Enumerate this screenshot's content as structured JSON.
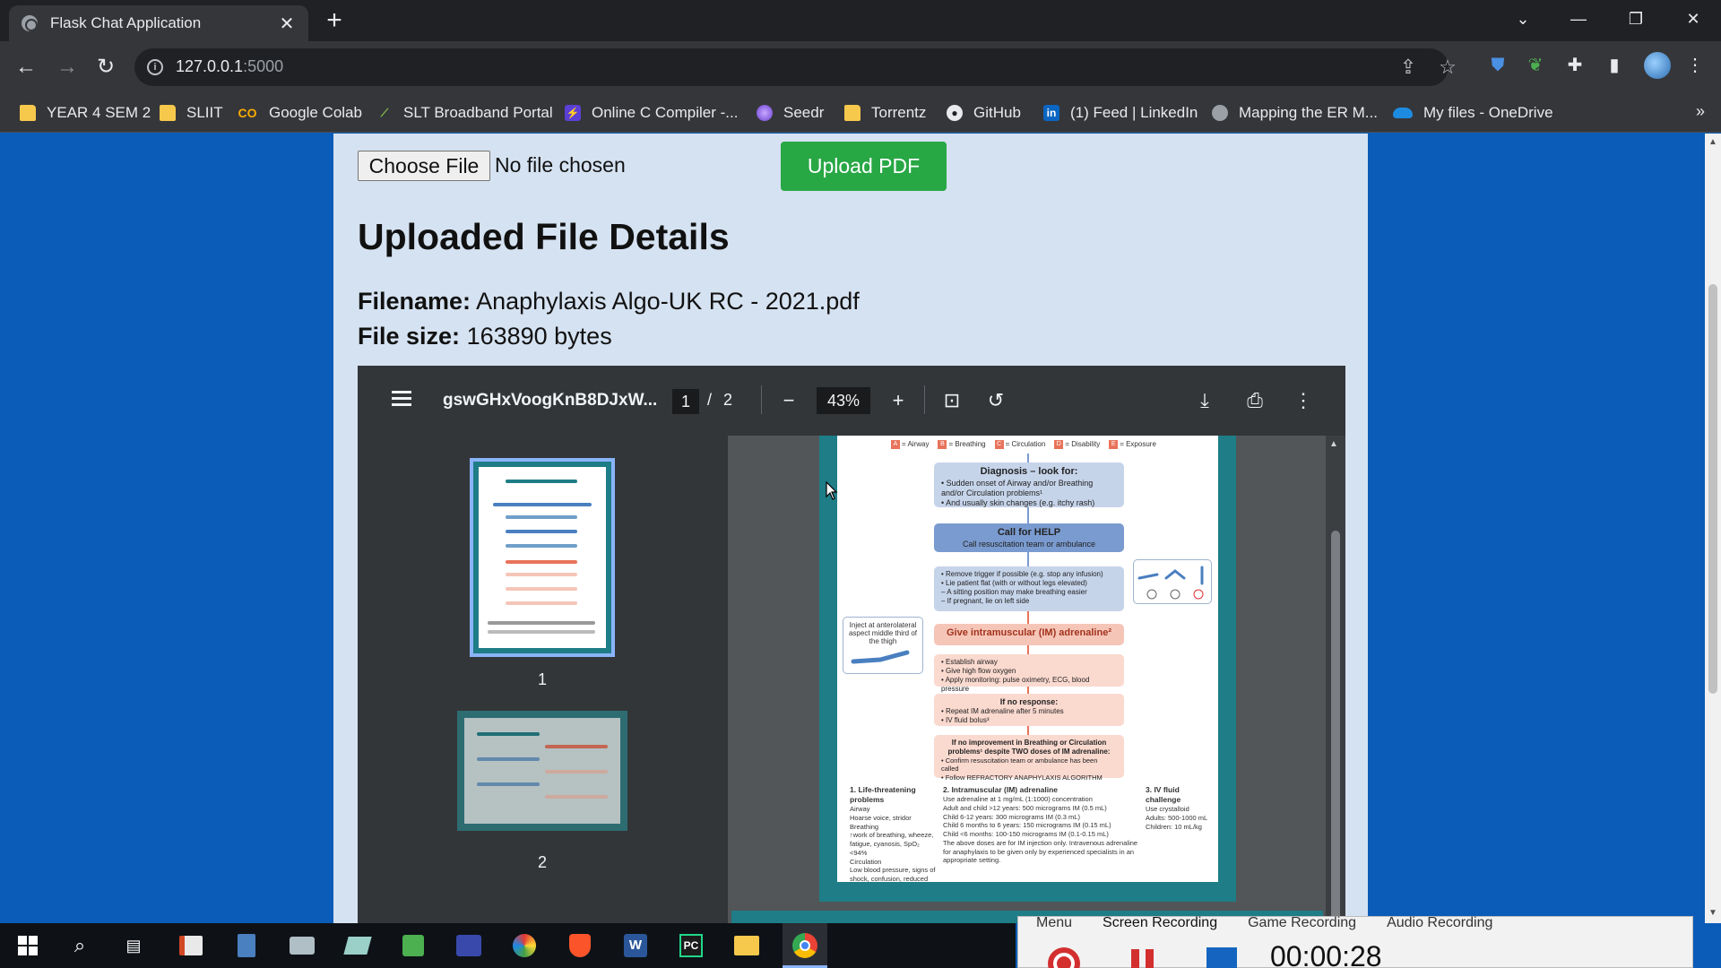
{
  "browser": {
    "tab_title": "Flask Chat Application",
    "url_host": "127.0.0.1",
    "url_port": ":5000"
  },
  "bookmarks": [
    {
      "label": "YEAR 4 SEM 2",
      "icon": "folder-icon"
    },
    {
      "label": "SLIIT",
      "icon": "folder-icon"
    },
    {
      "label": "Google Colab",
      "icon": "colab-icon"
    },
    {
      "label": "SLT Broadband Portal",
      "icon": "slt-icon"
    },
    {
      "label": "Online C Compiler -...",
      "icon": "compiler-icon"
    },
    {
      "label": "Seedr",
      "icon": "seedr-icon"
    },
    {
      "label": "Torrentz",
      "icon": "folder-icon"
    },
    {
      "label": "GitHub",
      "icon": "github-icon"
    },
    {
      "label": "(1) Feed | LinkedIn",
      "icon": "linkedin-icon"
    },
    {
      "label": "Mapping the ER M...",
      "icon": "globe-icon"
    },
    {
      "label": "My files - OneDrive",
      "icon": "onedrive-icon"
    }
  ],
  "upload": {
    "choose_label": "Choose File",
    "no_file": "No file chosen",
    "upload_label": "Upload PDF"
  },
  "details": {
    "title": "Uploaded File Details",
    "filename_label": "Filename:",
    "filename_value": "Anaphylaxis Algo-UK RC - 2021.pdf",
    "filesize_label": "File size:",
    "filesize_value": "163890 bytes"
  },
  "viewer": {
    "doc_name": "gswGHxVoogKnB8DJxW...",
    "current_page": "1",
    "page_sep": "/",
    "total_pages": "2",
    "zoom": "43%",
    "thumb_labels": [
      "1",
      "2"
    ]
  },
  "flowchart": {
    "abcde": [
      {
        "letter": "A",
        "label": "= Airway"
      },
      {
        "letter": "B",
        "label": "= Breathing"
      },
      {
        "letter": "C",
        "label": "= Circulation"
      },
      {
        "letter": "D",
        "label": "= Disability"
      },
      {
        "letter": "E",
        "label": "= Exposure"
      }
    ],
    "diagnosis_title": "Diagnosis – look for:",
    "diagnosis_items": [
      "• Sudden onset of Airway and/or Breathing and/or Circulation problems¹",
      "• And usually skin changes (e.g. itchy rash)"
    ],
    "help_title": "Call for HELP",
    "help_sub": "Call resuscitation team or ambulance",
    "trigger_items": [
      "• Remove trigger if possible (e.g. stop any infusion)",
      "• Lie patient flat (with or without legs elevated)",
      "– A sitting position may make breathing easier",
      "– If pregnant, lie on left side"
    ],
    "im_title": "Give intramuscular (IM) adrenaline²",
    "inject_note": "Inject at anterolateral aspect middle third of the thigh",
    "airway_items": [
      "• Establish airway",
      "• Give high flow oxygen",
      "• Apply monitoring: pulse oximetry, ECG, blood pressure"
    ],
    "noresp_title": "If no response:",
    "noresp_items": [
      "• Repeat IM adrenaline after 5 minutes",
      "• IV fluid bolus³"
    ],
    "noimprove_title": "If no improvement in Breathing or Circulation problems¹ despite TWO doses of IM adrenaline:",
    "noimprove_items": [
      "• Confirm resuscitation team or ambulance has been called",
      "• Follow REFRACTORY ANAPHYLAXIS ALGORITHM"
    ],
    "notes": {
      "n1_title": "1. Life-threatening problems",
      "n1_body": "Airway\nHoarse voice, stridor\nBreathing\n↑work of breathing, wheeze, fatigue, cyanosis, SpO₂ <94%\nCirculation\nLow blood pressure, signs of shock, confusion, reduced consciousness",
      "n2_title": "2. Intramuscular (IM) adrenaline",
      "n2_body": "Use adrenaline at 1 mg/mL (1:1000) concentration\nAdult and child >12 years: 500 micrograms IM (0.5 mL)\nChild 6-12 years: 300 micrograms IM (0.3 mL)\nChild 6 months to 6 years: 150 micrograms IM (0.15 mL)\nChild <6 months: 100-150 micrograms IM (0.1-0.15 mL)\nThe above doses are for IM injection only. Intravenous adrenaline for anaphylaxis to be given only by experienced specialists in an appropriate setting.",
      "n3_title": "3. IV fluid challenge",
      "n3_body": "Use crystalloid\nAdults: 500-1000 mL\nChildren: 10 mL/kg"
    }
  },
  "recorder": {
    "tabs": [
      "Menu",
      "Screen Recording",
      "Game Recording",
      "Audio Recording"
    ],
    "time": "00:00:28"
  }
}
